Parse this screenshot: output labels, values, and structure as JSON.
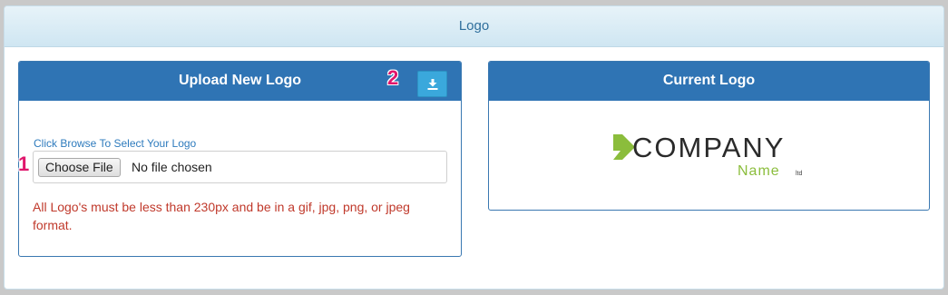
{
  "outer": {
    "title": "Logo"
  },
  "upload_panel": {
    "title": "Upload New Logo",
    "download_icon": "download-icon",
    "field_label": "Click Browse To Select Your Logo",
    "choose_button_label": "Choose File",
    "no_file_text": "No file chosen",
    "note": "All Logo's must be less than 230px and be in a gif, jpg, png, or jpeg format."
  },
  "current_panel": {
    "title": "Current Logo",
    "logo": {
      "company_text": "COMPANY",
      "name_text": "Name",
      "ltd_text": "ltd",
      "accent_color": "#8bbd3c"
    }
  },
  "annotations": {
    "badge_1": "1",
    "badge_2": "2"
  },
  "colors": {
    "panel_header": "#2f74b4",
    "download_button": "#3aa8dc",
    "note_text": "#c0392b",
    "badge": "#e0176c"
  }
}
